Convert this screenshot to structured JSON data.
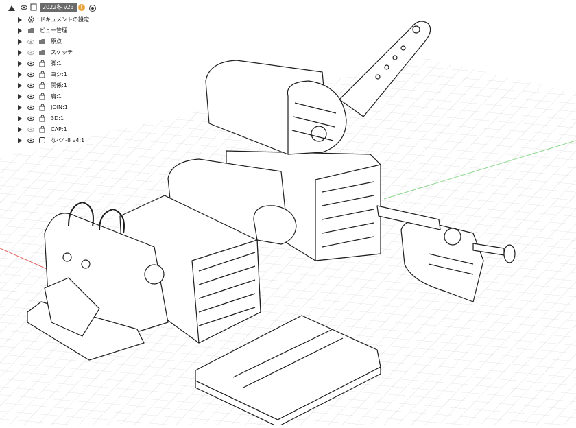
{
  "root": {
    "label": "2022冬 v23",
    "badge": "!"
  },
  "tree": [
    {
      "label": "ドキュメントの設定",
      "icon": "gear-icon",
      "eye": false
    },
    {
      "label": "ビュー管理",
      "icon": "folder-icon",
      "eye": false
    },
    {
      "label": "原点",
      "icon": "folder-icon",
      "eye": true,
      "hidden": true
    },
    {
      "label": "スケッチ",
      "icon": "folder-icon",
      "eye": true,
      "hidden": true
    },
    {
      "label": "脚:1",
      "icon": "component-icon",
      "eye": true
    },
    {
      "label": "ヨシ:1",
      "icon": "component-icon",
      "eye": true
    },
    {
      "label": "関係:1",
      "icon": "component-icon",
      "eye": true
    },
    {
      "label": "肩:1",
      "icon": "component-icon",
      "eye": true
    },
    {
      "label": "JOIN:1",
      "icon": "component-icon",
      "eye": true
    },
    {
      "label": "3D:1",
      "icon": "component-icon",
      "eye": true
    },
    {
      "label": "CAP:1",
      "icon": "component-icon",
      "eye": true,
      "hidden": true
    },
    {
      "label": "なべ4-8 v4:1",
      "icon": "body-icon",
      "eye": true
    }
  ],
  "colors": {
    "grid": "#d9d9d9",
    "axis_red": "#e06060",
    "axis_green": "#7fd07f",
    "model_stroke": "#1e1e1e"
  }
}
